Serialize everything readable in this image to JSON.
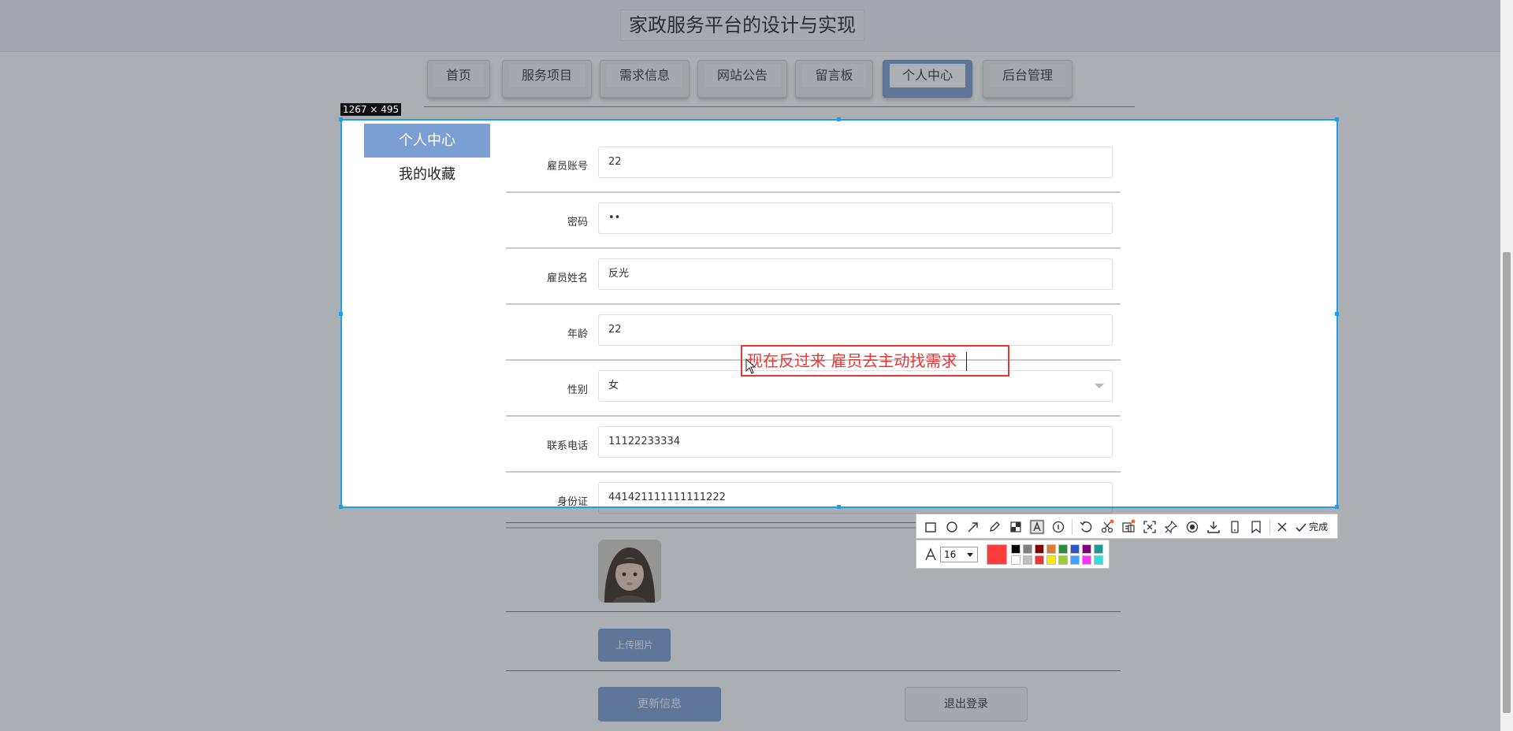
{
  "site": {
    "title": "家政服务平台的设计与实现"
  },
  "nav": {
    "items": [
      {
        "label": "首页"
      },
      {
        "label": "服务项目"
      },
      {
        "label": "需求信息"
      },
      {
        "label": "网站公告"
      },
      {
        "label": "留言板"
      },
      {
        "label": "个人中心"
      },
      {
        "label": "后台管理"
      }
    ],
    "active": "个人中心"
  },
  "sidebar": {
    "items": [
      {
        "label": "个人中心"
      },
      {
        "label": "我的收藏"
      }
    ]
  },
  "form": {
    "fields": [
      {
        "label": "雇员账号",
        "value": "22"
      },
      {
        "label": "密码",
        "value": "••"
      },
      {
        "label": "雇员姓名",
        "value": "反光"
      },
      {
        "label": "年龄",
        "value": "22"
      },
      {
        "label": "性别",
        "value": "女"
      },
      {
        "label": "联系电话",
        "value": "11122233334"
      },
      {
        "label": "身份证",
        "value": "441421111111111222"
      }
    ],
    "upload_label": "上传图片",
    "update_label": "更新信息",
    "logout_label": "退出登录"
  },
  "screenshot_tool": {
    "selection_size": "1267 × 495",
    "annotation_text": "现在反过来 雇员去主动找需求",
    "font_size": "16",
    "done_label": "完成",
    "current_color": "#ff3b3b",
    "palette": [
      "#000000",
      "#808080",
      "#800000",
      "#e07a2f",
      "#2e8b3a",
      "#3355cc",
      "#800080",
      "#1a9a9a",
      "#ffffff",
      "#c0c0c0",
      "#e53935",
      "#ffeb00",
      "#9acd32",
      "#3fa0ff",
      "#ff33ff",
      "#33dddd"
    ],
    "tools": [
      "rectangle-icon",
      "ellipse-icon",
      "arrow-icon",
      "pencil-icon",
      "mosaic-icon",
      "text-icon",
      "number-icon",
      "undo-icon",
      "cut-icon",
      "ocr-icon",
      "crop-icon",
      "pin-icon",
      "record-icon",
      "download-icon",
      "phone-icon",
      "bookmark-icon",
      "close-icon",
      "check-icon"
    ]
  }
}
